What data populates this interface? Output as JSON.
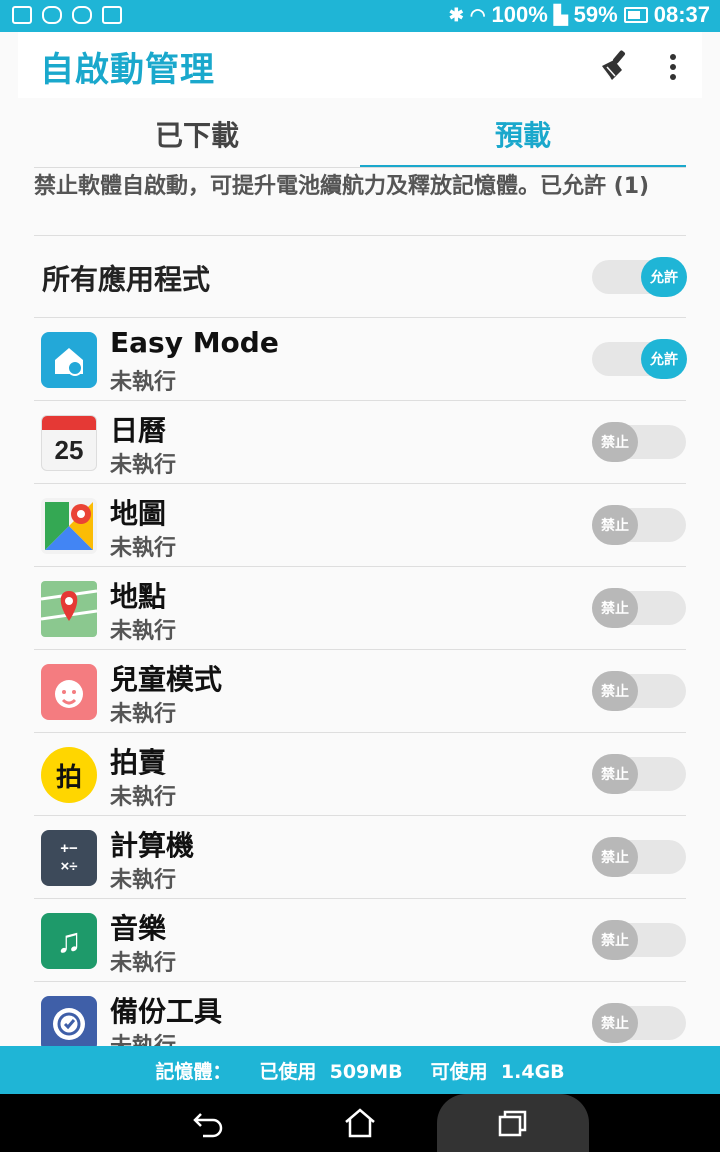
{
  "statusbar": {
    "wifi_battery": "100%",
    "battery_pct": "59%",
    "time": "08:37"
  },
  "header": {
    "title": "自啟動管理"
  },
  "tabs": [
    {
      "label": "已下載",
      "active": false
    },
    {
      "label": "預載",
      "active": true
    }
  ],
  "description": "禁止軟體自啟動，可提升電池續航力及釋放記憶體。已允許 (1)",
  "all_apps": {
    "label": "所有應用程式",
    "toggle": "允許",
    "state": "on"
  },
  "apps": [
    {
      "name": "Easy Mode",
      "status": "未執行",
      "toggle": "允許",
      "state": "on",
      "icon": "easy-mode-icon",
      "color": "#23a8d8"
    },
    {
      "name": "日曆",
      "status": "未執行",
      "toggle": "禁止",
      "state": "off",
      "icon": "calendar-icon",
      "color": "#ffffff",
      "icon_text": "25"
    },
    {
      "name": "地圖",
      "status": "未執行",
      "toggle": "禁止",
      "state": "off",
      "icon": "maps-icon",
      "color": "#ffffff"
    },
    {
      "name": "地點",
      "status": "未執行",
      "toggle": "禁止",
      "state": "off",
      "icon": "places-icon",
      "color": "#7cc576"
    },
    {
      "name": "兒童模式",
      "status": "未執行",
      "toggle": "禁止",
      "state": "off",
      "icon": "kids-mode-icon",
      "color": "#f47c80"
    },
    {
      "name": "拍賣",
      "status": "未執行",
      "toggle": "禁止",
      "state": "off",
      "icon": "auction-icon",
      "color": "#ffd600",
      "icon_text": "拍"
    },
    {
      "name": "計算機",
      "status": "未執行",
      "toggle": "禁止",
      "state": "off",
      "icon": "calculator-icon",
      "color": "#3d4a5a",
      "icon_text": "+−\n×÷"
    },
    {
      "name": "音樂",
      "status": "未執行",
      "toggle": "禁止",
      "state": "off",
      "icon": "music-icon",
      "color": "#1e9a6a",
      "icon_text": "♫"
    },
    {
      "name": "備份工具",
      "status": "未執行",
      "toggle": "禁止",
      "state": "off",
      "icon": "backup-icon",
      "color": "#3f5fa8"
    }
  ],
  "memory": {
    "label": "記憶體：",
    "used_label": "已使用",
    "used": "509MB",
    "free_label": "可使用",
    "free": "1.4GB"
  },
  "colors": {
    "accent": "#1fb5d6",
    "title": "#1aa8cc"
  }
}
